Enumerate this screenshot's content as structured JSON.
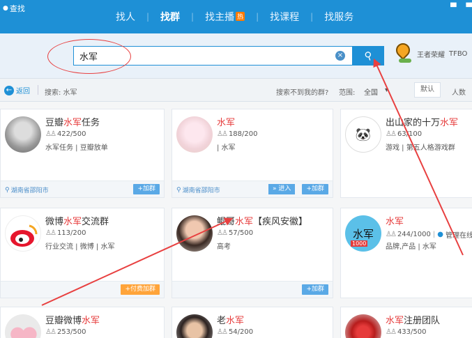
{
  "app": {
    "title": "查找"
  },
  "nav": {
    "tabs": [
      {
        "label": "找人",
        "active": false
      },
      {
        "label": "找群",
        "active": true
      },
      {
        "label": "找主播",
        "active": false,
        "badge": "热"
      },
      {
        "label": "找课程",
        "active": false
      },
      {
        "label": "找服务",
        "active": false
      }
    ]
  },
  "search": {
    "value": "水军",
    "button_icon": "search-icon"
  },
  "promo": {
    "label": "王者荣耀",
    "label2": "TFBO"
  },
  "filter": {
    "back_label": "返回",
    "query_text": "搜索: 水军",
    "not_found": "搜索不到我的群?",
    "range_label": "范围:",
    "range_value": "全国",
    "sort_default": "默认",
    "sort_count": "人数"
  },
  "cards": [
    {
      "name_pre": "豆瓣",
      "name_hl": "水军",
      "name_post": "任务",
      "members": "422/500",
      "tags": "水军任务 | 豆瓣放单",
      "location": "湖南省邵阳市",
      "join": "+加群"
    },
    {
      "name_pre": "",
      "name_hl": "水军",
      "name_post": "",
      "members": "188/200",
      "tags": "| 水军",
      "location": "湖南省邵阳市",
      "enter": "» 进入",
      "join": "+加群"
    },
    {
      "name_pre": "出山家的十万",
      "name_hl": "水军",
      "name_post": "",
      "members": "63/100",
      "tags": "游戏 | 第五人格游戏群"
    },
    {
      "name_pre": "微博",
      "name_hl": "水军",
      "name_post": "交流群",
      "members": "113/200",
      "tags": "行业交流 | 微博 | 水军",
      "join": "+付费加群"
    },
    {
      "name_pre": "鲲哥",
      "name_hl": "水军",
      "name_post": "【疾风安徽】",
      "members": "57/500",
      "tags": "高考",
      "join": "+加群"
    },
    {
      "name_pre": "",
      "name_hl": "水军",
      "name_post": "",
      "members": "244/1000",
      "manage": "管理在线",
      "tags": "品牌,产品 | 水军",
      "avatar_text": "水军",
      "badge": "1000"
    },
    {
      "name_pre": "豆瓣微博",
      "name_hl": "水军",
      "name_post": "",
      "members": "253/500"
    },
    {
      "name_pre": "老",
      "name_hl": "水军",
      "name_post": "",
      "members": "54/200"
    },
    {
      "name_pre": "",
      "name_hl": "水军",
      "name_post": "注册团队",
      "members": "433/500"
    }
  ],
  "colors": {
    "accent": "#1e90d6",
    "highlight": "#e63b3b",
    "annotation": "#e84040"
  }
}
